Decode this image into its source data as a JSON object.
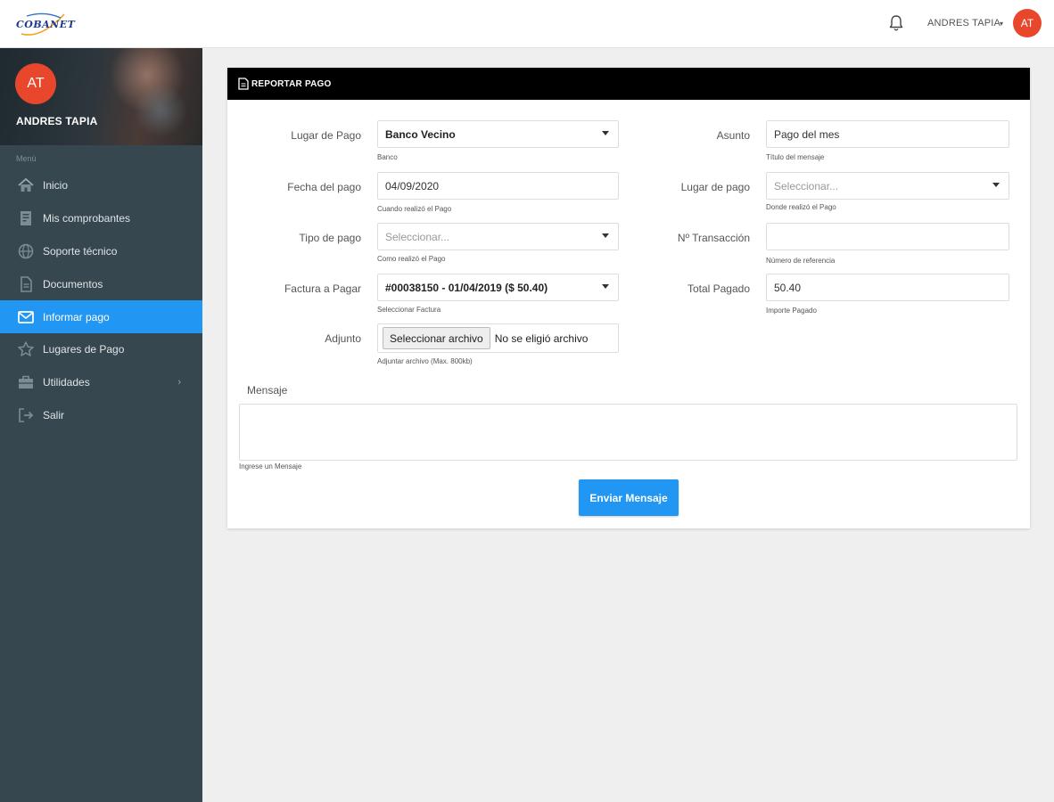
{
  "app": {
    "logo_text": "COBANET"
  },
  "header": {
    "user_name": "ANDRES TAPIA",
    "caret": "▾",
    "avatar_initials": "AT"
  },
  "sidebar": {
    "profile": {
      "avatar_initials": "AT",
      "name": "ANDRES TAPIA"
    },
    "menu_label": "Menú",
    "items": [
      {
        "label": "Inicio",
        "icon": "home-icon",
        "active": false
      },
      {
        "label": "Mis comprobantes",
        "icon": "receipt-icon",
        "active": false
      },
      {
        "label": "Soporte técnico",
        "icon": "globe-icon",
        "active": false
      },
      {
        "label": "Documentos",
        "icon": "document-icon",
        "active": false
      },
      {
        "label": "Informar pago",
        "icon": "envelope-icon",
        "active": true
      },
      {
        "label": "Lugares de Pago",
        "icon": "star-icon",
        "active": false
      },
      {
        "label": "Utilidades",
        "icon": "briefcase-icon",
        "active": false,
        "chevron": "›"
      },
      {
        "label": "Salir",
        "icon": "logout-icon",
        "active": false
      }
    ]
  },
  "form": {
    "title": "REPORTAR PAGO",
    "lugar_de_pago": {
      "label": "Lugar de Pago",
      "value": "Banco Vecino",
      "hint": "Banco"
    },
    "fecha_del_pago": {
      "label": "Fecha del pago",
      "value": "04/09/2020",
      "hint": "Cuando realizó el Pago"
    },
    "tipo_de_pago": {
      "label": "Tipo de pago",
      "placeholder": "Seleccionar...",
      "hint": "Como realizó el Pago"
    },
    "factura_a_pagar": {
      "label": "Factura a Pagar",
      "value": "#00038150 - 01/04/2019 ($ 50.40)",
      "hint": "Seleccionar Factura"
    },
    "adjunto": {
      "label": "Adjunto",
      "button": "Seleccionar archivo",
      "status": "No se eligió archivo",
      "hint": "Adjuntar archivo (Max. 800kb)"
    },
    "asunto": {
      "label": "Asunto",
      "value": "Pago del mes",
      "hint": "Título del mensaje"
    },
    "lugar_de_pago_2": {
      "label": "Lugar de pago",
      "placeholder": "Seleccionar...",
      "hint": "Donde realizó el Pago"
    },
    "transaccion": {
      "label": "Nº Transacción",
      "value": "",
      "hint": "Número de referencia"
    },
    "total_pagado": {
      "label": "Total Pagado",
      "value": "50.40",
      "hint": "Importe Pagado"
    },
    "mensaje": {
      "label": "Mensaje",
      "value": "",
      "hint": "Ingrese un Mensaje"
    },
    "submit": "Enviar Mensaje"
  },
  "colors": {
    "accent": "#2196f3",
    "sidebar": "#37474f",
    "avatar": "#e8472c",
    "header_bar": "#000000"
  }
}
